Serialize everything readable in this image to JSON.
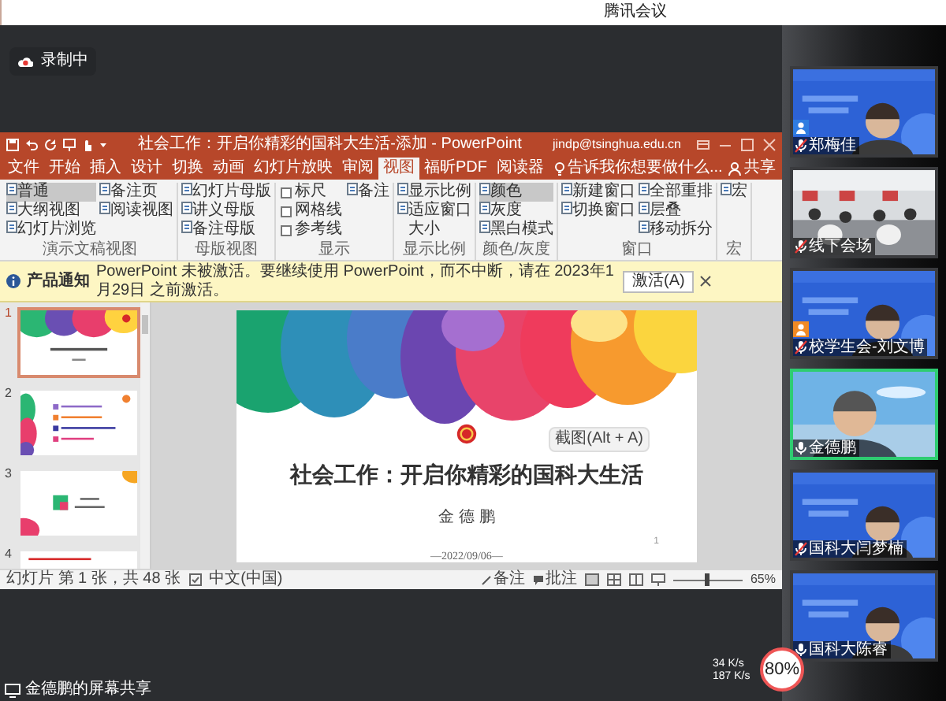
{
  "meeting": {
    "app_title": "腾讯会议",
    "recording": "录制中",
    "share_label": "金德鹏的屏幕共享",
    "net_up": "34 K/s",
    "net_down": "187 K/s",
    "quality": "80%"
  },
  "powerpoint": {
    "title": "社会工作：开启你精彩的国科大生活-添加 - PowerPoint",
    "account": "jindp@tsinghua.edu.cn",
    "share": "共享",
    "tabs": [
      {
        "label": "文件",
        "selected": false
      },
      {
        "label": "开始",
        "selected": false
      },
      {
        "label": "插入",
        "selected": false
      },
      {
        "label": "设计",
        "selected": false
      },
      {
        "label": "切换",
        "selected": false
      },
      {
        "label": "动画",
        "selected": false
      },
      {
        "label": "幻灯片放映",
        "selected": false
      },
      {
        "label": "审阅",
        "selected": false
      },
      {
        "label": "视图",
        "selected": true
      },
      {
        "label": "福昕PDF",
        "selected": false
      },
      {
        "label": "阅读器",
        "selected": false
      }
    ],
    "tell_me": "告诉我你想要做什么...",
    "ribbon_groups": [
      {
        "label": "演示文稿视图",
        "columns": [
          [
            {
              "kind": "button",
              "label": "普通",
              "selected": true
            },
            {
              "kind": "button",
              "label": "大纲视图",
              "selected": false
            },
            {
              "kind": "button",
              "label": "幻灯片浏览",
              "selected": false
            }
          ],
          [
            {
              "kind": "button",
              "label": "备注页",
              "selected": false
            },
            {
              "kind": "button",
              "label": "阅读视图",
              "selected": false
            }
          ]
        ]
      },
      {
        "label": "母版视图",
        "columns": [
          [
            {
              "kind": "button",
              "label": "幻灯片母版"
            },
            {
              "kind": "button",
              "label": "讲义母版"
            },
            {
              "kind": "button",
              "label": "备注母版"
            }
          ]
        ]
      },
      {
        "label": "显示",
        "columns": [
          [
            {
              "kind": "checkbox",
              "label": "标尺",
              "checked": false
            },
            {
              "kind": "checkbox",
              "label": "网格线",
              "checked": false
            },
            {
              "kind": "checkbox",
              "label": "参考线",
              "checked": false
            }
          ],
          [
            {
              "kind": "button",
              "label": "备注"
            }
          ]
        ]
      },
      {
        "label": "显示比例",
        "columns": [
          [
            {
              "kind": "button",
              "label": "显示比例"
            },
            {
              "kind": "button",
              "label": "适应窗口大小"
            }
          ]
        ]
      },
      {
        "label": "颜色/灰度",
        "columns": [
          [
            {
              "kind": "button",
              "label": "颜色",
              "selected": true
            },
            {
              "kind": "button",
              "label": "灰度",
              "selected": false
            },
            {
              "kind": "button",
              "label": "黑白模式",
              "selected": false
            }
          ]
        ]
      },
      {
        "label": "窗口",
        "columns": [
          [
            {
              "kind": "button",
              "label": "新建窗口"
            },
            {
              "kind": "button",
              "label": "切换窗口"
            }
          ],
          [
            {
              "kind": "button",
              "label": "全部重排"
            },
            {
              "kind": "button",
              "label": "层叠"
            },
            {
              "kind": "button",
              "label": "移动拆分"
            }
          ]
        ]
      },
      {
        "label": "宏",
        "columns": [
          [
            {
              "kind": "button",
              "label": "宏"
            }
          ]
        ]
      }
    ],
    "notice": {
      "title": "产品通知",
      "message": "PowerPoint 未被激活。要继续使用 PowerPoint，而不中断，请在 2023年1月29日 之前激活。",
      "button": "激活(A)"
    },
    "thumbnails": [
      {
        "number": "1",
        "selected": true,
        "kind": "cover"
      },
      {
        "number": "2",
        "selected": false,
        "kind": "agenda"
      },
      {
        "number": "3",
        "selected": false,
        "kind": "section"
      },
      {
        "number": "4",
        "selected": false,
        "kind": "text"
      }
    ],
    "slide": {
      "title": "社会工作：开启你精彩的国科大生活",
      "author": "金 德 鹏",
      "date": "—2022/09/06—",
      "page": "1",
      "tooltip": "截图(Alt + A)"
    },
    "status_bar": {
      "slide_info": "幻灯片 第 1 张，共 48 张",
      "language": "中文(中国)",
      "notes": "备注",
      "comments": "批注",
      "zoom_slider": {
        "level": 0.5
      },
      "zoom": "65%"
    }
  },
  "participants": [
    {
      "name": "郑梅佳",
      "role_badge": {
        "color": "#2f7de1"
      },
      "muted": true,
      "speaking": false,
      "kind": "backdrop"
    },
    {
      "name": "线下会场",
      "muted": true,
      "speaking": false,
      "kind": "room"
    },
    {
      "name": "校学生会-刘文博",
      "role_badge": {
        "color": "#f08a24"
      },
      "muted": true,
      "speaking": false,
      "kind": "backdrop"
    },
    {
      "name": "金德鹏",
      "muted": false,
      "speaking": true,
      "kind": "outdoor"
    },
    {
      "name": "国科大闫梦楠",
      "muted": true,
      "speaking": false,
      "kind": "backdrop"
    },
    {
      "name": "国科大陈睿",
      "muted": false,
      "speaking": false,
      "kind": "backdrop"
    }
  ]
}
